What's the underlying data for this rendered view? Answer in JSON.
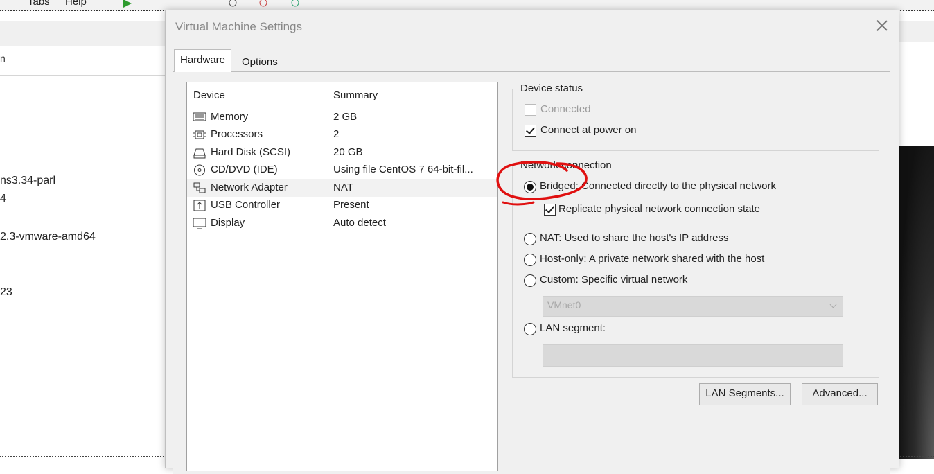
{
  "background": {
    "menu": {
      "tabs": "Tabs",
      "help": "Help"
    },
    "search_text": "n",
    "list_lines": [
      "ns3.34-parl",
      "4",
      "2.3-vmware-amd64",
      "23"
    ]
  },
  "dialog": {
    "title": "Virtual Machine Settings",
    "tabs": [
      {
        "label": "Hardware",
        "active": true
      },
      {
        "label": "Options",
        "active": false
      }
    ],
    "device_list": {
      "col_device": "Device",
      "col_summary": "Summary",
      "rows": [
        {
          "icon": "memory-icon",
          "name": "Memory",
          "summary": "2 GB"
        },
        {
          "icon": "processor-icon",
          "name": "Processors",
          "summary": "2"
        },
        {
          "icon": "hard-disk-icon",
          "name": "Hard Disk (SCSI)",
          "summary": "20 GB"
        },
        {
          "icon": "cd-dvd-icon",
          "name": "CD/DVD (IDE)",
          "summary": "Using file CentOS 7 64-bit-fil..."
        },
        {
          "icon": "network-adapter-icon",
          "name": "Network Adapter",
          "summary": "NAT",
          "selected": true
        },
        {
          "icon": "usb-icon",
          "name": "USB Controller",
          "summary": "Present"
        },
        {
          "icon": "display-icon",
          "name": "Display",
          "summary": "Auto detect"
        }
      ]
    },
    "device_status": {
      "title": "Device status",
      "connected": {
        "label": "Connected",
        "checked": false,
        "enabled": false
      },
      "connect_at_power_on": {
        "label": "Connect at power on",
        "checked": true
      }
    },
    "network_connection": {
      "title": "Network connection",
      "bridged": {
        "label": "Bridged: Connected directly to the physical network",
        "checked": true
      },
      "replicate": {
        "label": "Replicate physical network connection state",
        "checked": true
      },
      "nat": {
        "label": "NAT: Used to share the host's IP address",
        "checked": false
      },
      "host_only": {
        "label": "Host-only: A private network shared with the host",
        "checked": false
      },
      "custom": {
        "label": "Custom: Specific virtual network",
        "checked": false
      },
      "custom_select_value": "VMnet0",
      "lan_segment": {
        "label": "LAN segment:",
        "checked": false
      },
      "lan_segment_value": ""
    },
    "buttons": {
      "lan_segments": "LAN Segments...",
      "advanced": "Advanced..."
    },
    "annotation_color": "#e01010"
  }
}
